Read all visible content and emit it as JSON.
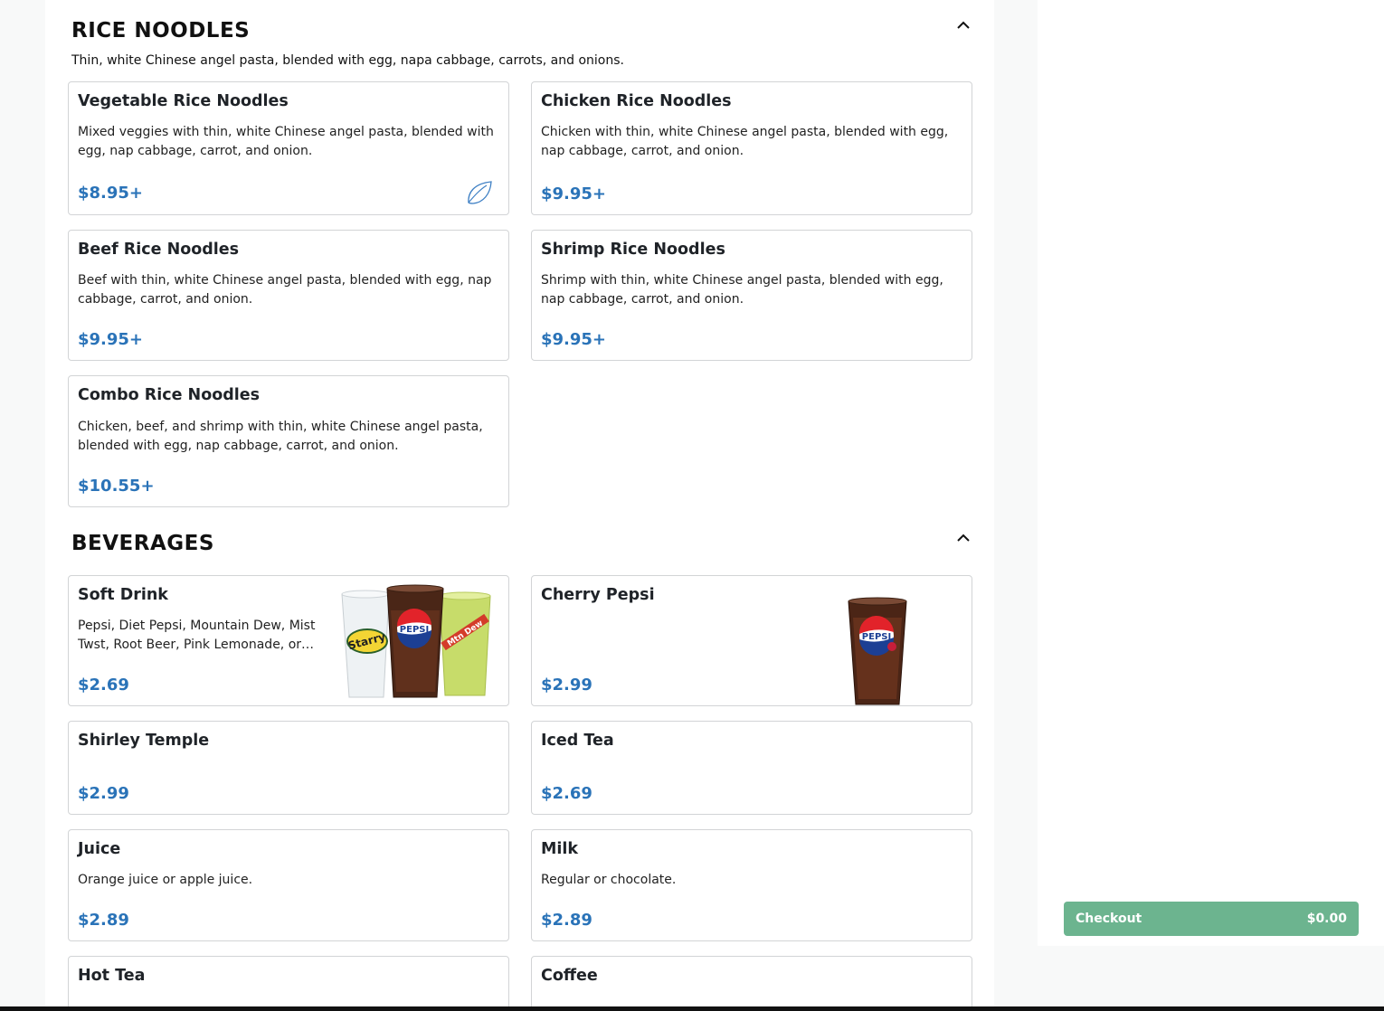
{
  "sections": [
    {
      "title": "RICE NOODLES",
      "description": "Thin, white Chinese angel pasta, blended with egg, napa cabbage, carrots, and onions.",
      "items": [
        {
          "name": "Vegetable Rice Noodles",
          "description": "Mixed veggies with thin, white Chinese angel pasta, blended with egg, nap cabbage, carrot, and onion.",
          "price": "$8.95+",
          "icon": "leaf-icon"
        },
        {
          "name": "Chicken Rice Noodles",
          "description": "Chicken with thin, white Chinese angel pasta, blended with egg, nap cabbage, carrot, and onion.",
          "price": "$9.95+"
        },
        {
          "name": "Beef Rice Noodles",
          "description": "Beef with thin, white Chinese angel pasta, blended with egg, nap cabbage, carrot, and onion.",
          "price": "$9.95+"
        },
        {
          "name": "Shrimp Rice Noodles",
          "description": "Shrimp with thin, white Chinese angel pasta, blended with egg, nap cabbage, carrot, and onion.",
          "price": "$9.95+"
        },
        {
          "name": "Combo Rice Noodles",
          "description": "Chicken, beef, and shrimp with thin, white Chinese angel pasta, blended with egg, nap cabbage, carrot, and onion.",
          "price": "$10.55+"
        }
      ]
    },
    {
      "title": "BEVERAGES",
      "items": [
        {
          "name": "Soft Drink",
          "description": "Pepsi, Diet Pepsi, Mountain Dew, Mist Twst, Root Beer, Pink Lemonade, or…",
          "price": "$2.69",
          "image": "soft-drink-cups-image",
          "image_text": [
            "Starry",
            "PEPSI",
            "Mtn Dew"
          ]
        },
        {
          "name": "Cherry Pepsi",
          "description": "",
          "price": "$2.99",
          "image": "cherry-pepsi-cup-image",
          "image_text": [
            "PEPSI"
          ]
        },
        {
          "name": "Shirley Temple",
          "description": "",
          "price": "$2.99"
        },
        {
          "name": "Iced Tea",
          "description": "",
          "price": "$2.69"
        },
        {
          "name": "Juice",
          "description": "Orange juice or apple juice.",
          "price": "$2.89"
        },
        {
          "name": "Milk",
          "description": "Regular or chocolate.",
          "price": "$2.89"
        },
        {
          "name": "Hot Tea",
          "description": "",
          "price": ""
        },
        {
          "name": "Coffee",
          "description": "",
          "price": ""
        }
      ]
    }
  ],
  "checkout": {
    "label": "Checkout",
    "total": "$0.00"
  },
  "colors": {
    "price": "#2a73b8",
    "checkout": "#6cb48f",
    "border": "#d2d4d6"
  }
}
